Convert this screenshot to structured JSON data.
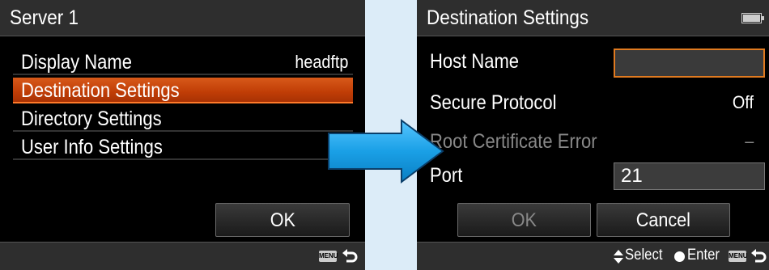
{
  "left_screen": {
    "title": "Server 1",
    "menu_items": [
      {
        "label": "Display Name",
        "value": "headftp"
      },
      {
        "label": "Destination Settings",
        "value": ""
      },
      {
        "label": "Directory Settings",
        "value": ""
      },
      {
        "label": "User Info Settings",
        "value": ""
      }
    ],
    "ok_label": "OK",
    "menu_key_label": "MENU"
  },
  "right_screen": {
    "title": "Destination Settings",
    "host_name_label": "Host Name",
    "host_name_value": "",
    "secure_protocol_label": "Secure Protocol",
    "secure_protocol_value": "Off",
    "root_cert_label": "Root Certificate Error",
    "root_cert_value": "–",
    "port_label": "Port",
    "port_value": "21",
    "ok_label": "OK",
    "cancel_label": "Cancel",
    "hint_select": "Select",
    "hint_enter": "Enter",
    "menu_key_label": "MENU"
  },
  "colors": {
    "background": "#dcecf8",
    "highlight": "#c8420a",
    "arrow": "#1aa0e6",
    "focus_border": "#e07a20"
  },
  "icons": [
    "battery-icon",
    "menu-button-icon",
    "back-arrow-icon",
    "arrow-right-icon",
    "updown-arrows-icon",
    "enter-dot-icon"
  ]
}
